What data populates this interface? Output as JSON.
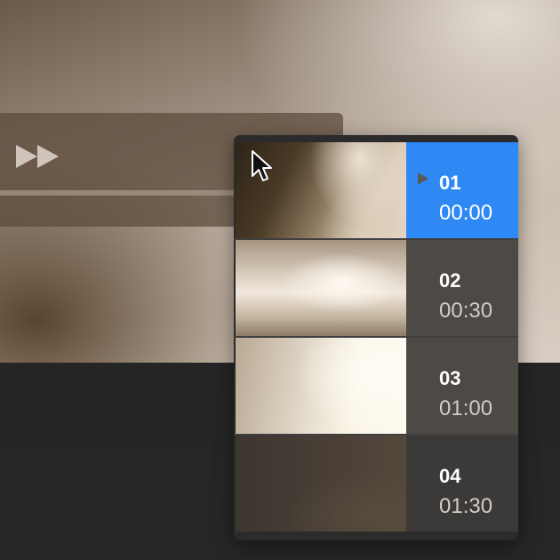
{
  "player": {
    "fast_forward_icon": "fast-forward-icon"
  },
  "chapters": [
    {
      "number": "01",
      "time": "00:00",
      "selected": true
    },
    {
      "number": "02",
      "time": "00:30",
      "selected": false
    },
    {
      "number": "03",
      "time": "01:00",
      "selected": false
    },
    {
      "number": "04",
      "time": "01:30",
      "selected": false
    }
  ],
  "colors": {
    "selected_highlight": "#2f89f4",
    "menu_background": "#2b2b2b",
    "info_cell": "#4d4945"
  },
  "icons": {
    "play_marker": "play-marker-icon",
    "cursor": "mouse-pointer-icon"
  }
}
